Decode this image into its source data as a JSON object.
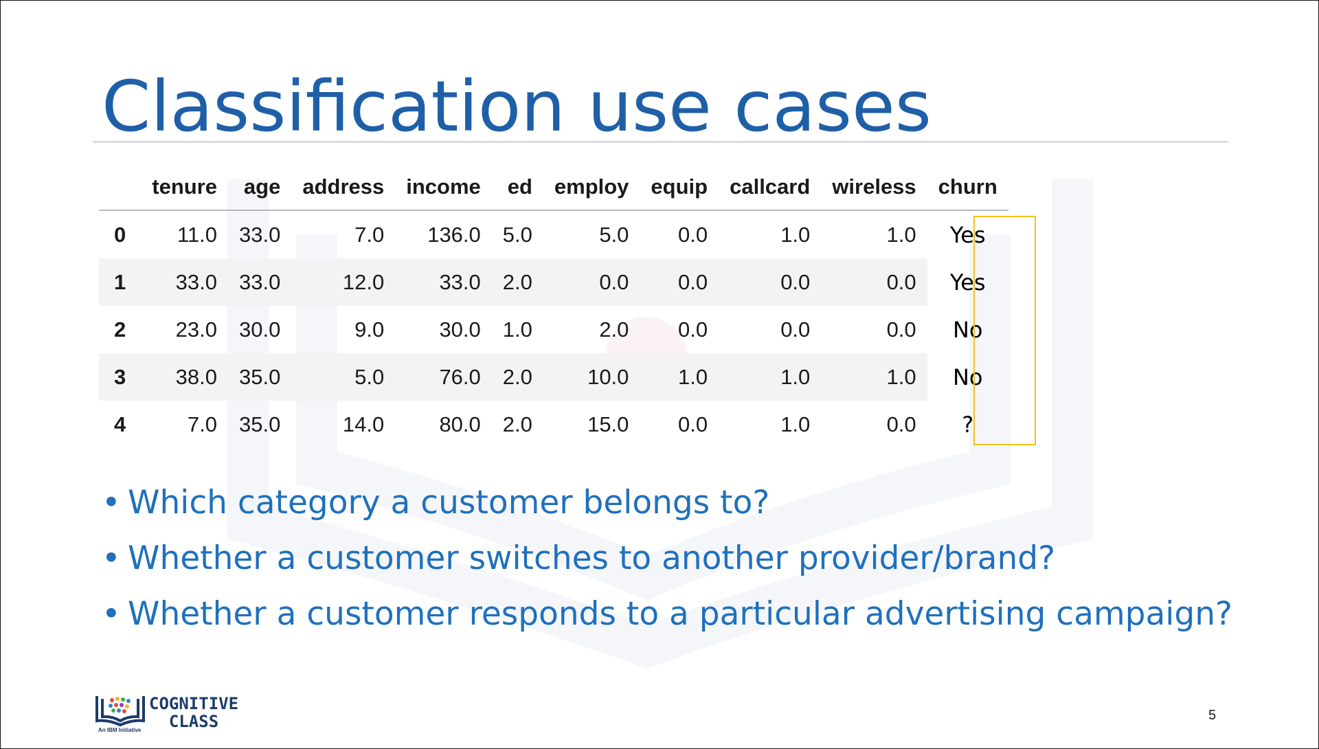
{
  "slide": {
    "title": "Classification use cases",
    "page_number": "5"
  },
  "table": {
    "columns": [
      "",
      "tenure",
      "age",
      "address",
      "income",
      "ed",
      "employ",
      "equip",
      "callcard",
      "wireless",
      "churn"
    ],
    "rows": [
      {
        "index": "0",
        "values": [
          "11.0",
          "33.0",
          "7.0",
          "136.0",
          "5.0",
          "5.0",
          "0.0",
          "1.0",
          "1.0"
        ],
        "churn": "Yes"
      },
      {
        "index": "1",
        "values": [
          "33.0",
          "33.0",
          "12.0",
          "33.0",
          "2.0",
          "0.0",
          "0.0",
          "0.0",
          "0.0"
        ],
        "churn": "Yes"
      },
      {
        "index": "2",
        "values": [
          "23.0",
          "30.0",
          "9.0",
          "30.0",
          "1.0",
          "2.0",
          "0.0",
          "0.0",
          "0.0"
        ],
        "churn": "No"
      },
      {
        "index": "3",
        "values": [
          "38.0",
          "35.0",
          "5.0",
          "76.0",
          "2.0",
          "10.0",
          "1.0",
          "1.0",
          "1.0"
        ],
        "churn": "No"
      },
      {
        "index": "4",
        "values": [
          "7.0",
          "35.0",
          "14.0",
          "80.0",
          "2.0",
          "15.0",
          "0.0",
          "1.0",
          "0.0"
        ],
        "churn": "?"
      }
    ]
  },
  "bullets": [
    "Which category a customer belongs to?",
    "Whether a customer switches to another provider/brand?",
    "Whether a customer responds to a particular advertising campaign?"
  ],
  "logo": {
    "line1": "COGNITIVE",
    "line2": "CLASS",
    "tagline": "An IBM Initiative",
    "icon": "open-book-with-dots-icon"
  },
  "colors": {
    "title": "#1f5fa8",
    "bullets": "#1f70bd",
    "churn_box": "#f0c21c",
    "row_shade": "#f3f3f3"
  }
}
